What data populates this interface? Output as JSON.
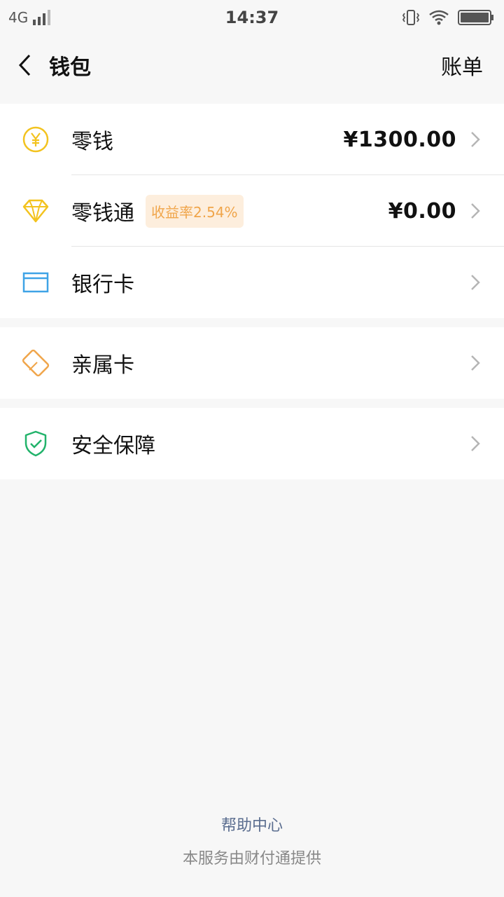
{
  "status_bar": {
    "network": "4G",
    "time": "14:37"
  },
  "nav": {
    "title": "钱包",
    "action_label": "账单"
  },
  "wallet_rows": [
    {
      "label": "零钱",
      "value": "¥1300.00",
      "icon": "yuan-coin-icon",
      "icon_color": "#f3c31f"
    },
    {
      "label": "零钱通",
      "tag": "收益率2.54%",
      "value": "¥0.00",
      "icon": "diamond-icon",
      "icon_color": "#f3c31f"
    },
    {
      "label": "银行卡",
      "icon": "bank-card-icon",
      "icon_color": "#3fa3e6"
    }
  ],
  "family_card": {
    "label": "亲属卡",
    "icon": "family-card-icon",
    "icon_color": "#f0a54a"
  },
  "security": {
    "label": "安全保障",
    "icon": "shield-check-icon",
    "icon_color": "#22b36b"
  },
  "footer": {
    "help_link": "帮助中心",
    "provider_note": "本服务由财付通提供"
  },
  "colors": {
    "background": "#f7f7f7",
    "tag_bg": "#fdeedd",
    "tag_text": "#f0a54a",
    "link": "#5a6d8f"
  }
}
